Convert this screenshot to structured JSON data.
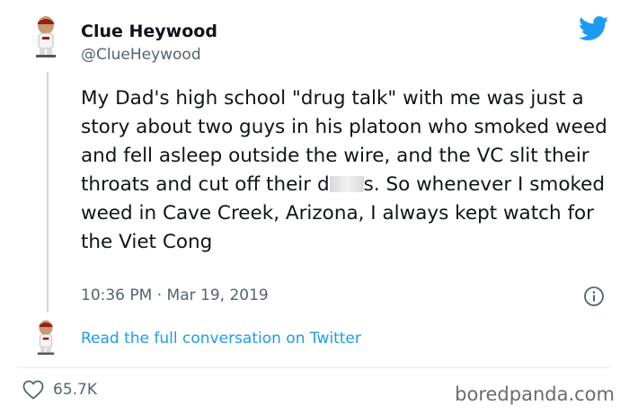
{
  "user": {
    "name": "Clue Heywood",
    "handle": "@ClueHeywood",
    "avatar_icon": "bobblehead-avatar"
  },
  "tweet": {
    "text_before_censor": "My Dad's high school \"drug talk\" with me was just a story about two guys in his platoon who smoked weed and fell asleep outside the wire, and the VC slit their throats and cut off their d",
    "text_after_censor": "s. So whenever I smoked weed in Cave Creek, Arizona, I always kept watch for the Viet Cong",
    "timestamp": "10:36 PM · Mar 19, 2019"
  },
  "conversation_link": "Read the full conversation on Twitter",
  "likes": "65.7K",
  "watermark": "boredpanda.com",
  "colors": {
    "link": "#1d9bf0",
    "brand": "#1d9bf0",
    "muted": "#536471"
  },
  "icons": [
    "twitter-bird-icon",
    "info-icon",
    "heart-icon"
  ]
}
